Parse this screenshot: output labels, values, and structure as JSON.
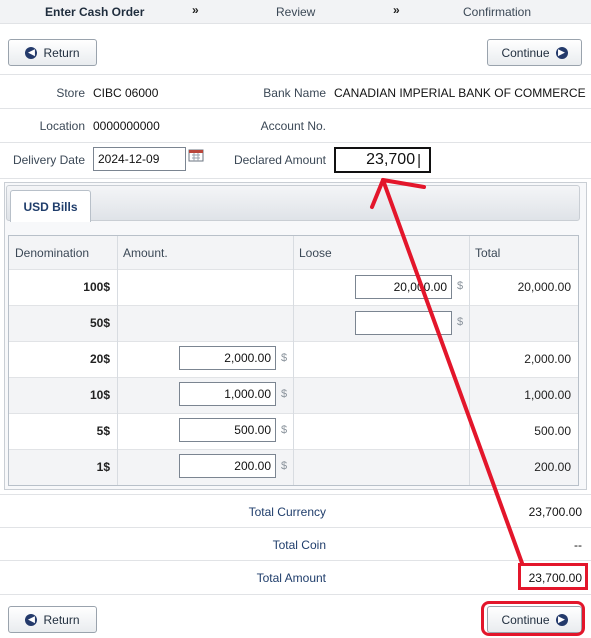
{
  "steps": {
    "step1": "Enter Cash Order",
    "sep1": "»",
    "step2": "Review",
    "sep2": "»",
    "step3": "Confirmation"
  },
  "buttons": {
    "return": "Return",
    "continue": "Continue"
  },
  "info": {
    "store_label": "Store",
    "store_value": "CIBC 06000",
    "bank_label": "Bank Name",
    "bank_value": "CANADIAN IMPERIAL BANK OF COMMERCE",
    "location_label": "Location",
    "location_value": "0000000000",
    "account_label": "Account No.",
    "account_value": "",
    "delivery_label": "Delivery Date",
    "delivery_value": "2024-12-09",
    "declared_label": "Declared Amount",
    "declared_value": "23,700"
  },
  "tab": {
    "label": "USD Bills"
  },
  "table": {
    "headers": [
      "Denomination",
      "Amount.",
      "Loose",
      "Total"
    ],
    "currency_symbol": "$",
    "rows": [
      {
        "denom": "100$",
        "amount": "",
        "loose": "20,000.00",
        "total": "20,000.00"
      },
      {
        "denom": "50$",
        "amount": "",
        "loose": "",
        "total": ""
      },
      {
        "denom": "20$",
        "amount": "2,000.00",
        "loose": "",
        "total": "2,000.00"
      },
      {
        "denom": "10$",
        "amount": "1,000.00",
        "loose": "",
        "total": "1,000.00"
      },
      {
        "denom": "5$",
        "amount": "500.00",
        "loose": "",
        "total": "500.00"
      },
      {
        "denom": "1$",
        "amount": "200.00",
        "loose": "",
        "total": "200.00"
      }
    ]
  },
  "summary": {
    "total_currency_label": "Total Currency",
    "total_currency_value": "23,700.00",
    "total_coin_label": "Total Coin",
    "total_coin_value": "--",
    "total_amount_label": "Total Amount",
    "total_amount_value": "23,700.00"
  },
  "colors": {
    "annotation": "#e3162b",
    "icon": "#243a6b"
  }
}
